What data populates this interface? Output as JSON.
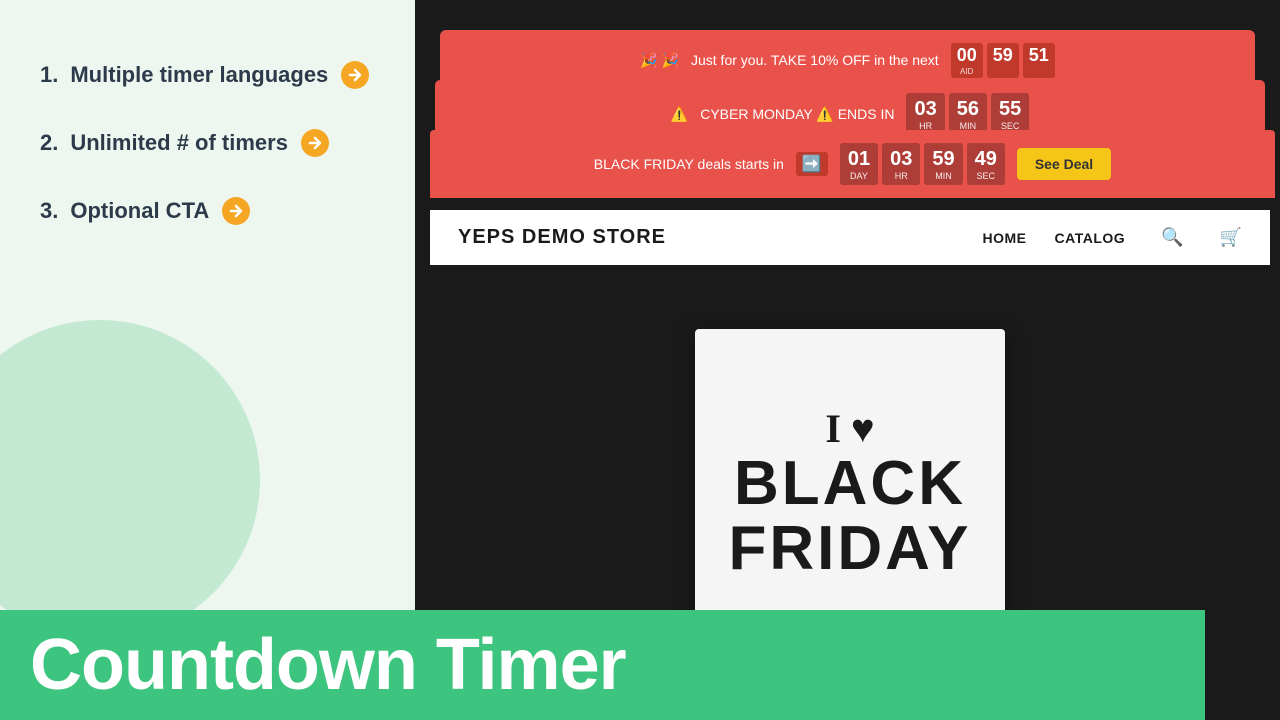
{
  "left": {
    "features": [
      {
        "number": "1.",
        "text": "Multiple timer languages"
      },
      {
        "number": "2.",
        "text": "Unlimited # of timers"
      },
      {
        "number": "3.",
        "text": "Optional CTA"
      }
    ]
  },
  "bottom_bar": {
    "title": "Countdown Timer"
  },
  "banners": [
    {
      "id": "banner1",
      "emoji_left": "🎉 🎉",
      "text": "Just for you. TAKE 10% OFF in the next",
      "timer": [
        {
          "num": "00",
          "lbl": "AID"
        },
        {
          "num": "59",
          "lbl": ""
        },
        {
          "num": "51",
          "lbl": ""
        }
      ]
    },
    {
      "id": "banner2",
      "emoji_left": "⚠️",
      "text": "CYBER MONDAY ⚠️ ENDS IN",
      "timer": [
        {
          "num": "03",
          "lbl": "HR"
        },
        {
          "num": "56",
          "lbl": "MIN"
        },
        {
          "num": "55",
          "lbl": "SEC"
        }
      ]
    },
    {
      "id": "banner3",
      "emoji_left": "➡️",
      "text": "BLACK FRIDAY deals starts in",
      "timer": [
        {
          "num": "01",
          "lbl": "DAY"
        },
        {
          "num": "03",
          "lbl": "HR"
        },
        {
          "num": "59",
          "lbl": "MIN"
        },
        {
          "num": "49",
          "lbl": "SEC"
        }
      ],
      "cta": "See Deal"
    }
  ],
  "store": {
    "logo": "YEPS DEMO STORE",
    "nav": [
      "HOME",
      "CATALOG"
    ],
    "hero": {
      "line1": "I ♥",
      "line2": "BLACK",
      "line3": "FRIDAY"
    }
  }
}
